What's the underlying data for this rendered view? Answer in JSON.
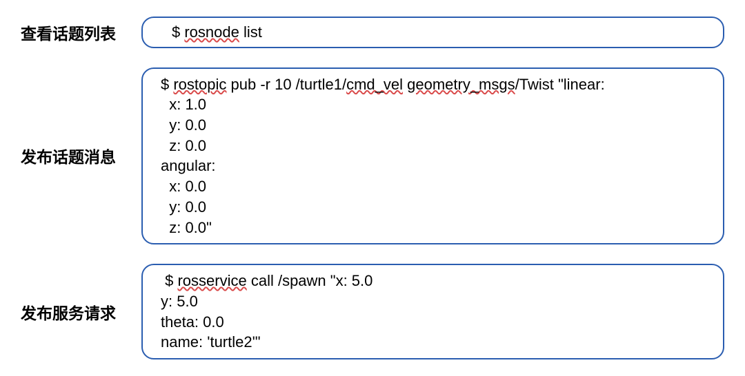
{
  "rows": [
    {
      "label": "查看话题列表",
      "parts": [
        {
          "text": "$ ",
          "u": false
        },
        {
          "text": "rosnode",
          "u": true
        },
        {
          "text": " list",
          "u": false
        }
      ],
      "single": true
    },
    {
      "label": "发布话题消息",
      "parts": [
        {
          "text": "$ ",
          "u": false
        },
        {
          "text": "rostopic",
          "u": true
        },
        {
          "text": " pub -r 10 /turtle1/",
          "u": false
        },
        {
          "text": "cmd_vel",
          "u": true
        },
        {
          "text": " ",
          "u": false
        },
        {
          "text": "geometry_msgs",
          "u": true
        },
        {
          "text": "/Twist \"linear:\n  x: 1.0\n  y: 0.0\n  z: 0.0\nangular:\n  x: 0.0\n  y: 0.0\n  z: 0.0\"",
          "u": false
        }
      ],
      "single": false
    },
    {
      "label": "发布服务请求",
      "parts": [
        {
          "text": " $ ",
          "u": false
        },
        {
          "text": "rosservice",
          "u": true
        },
        {
          "text": " call /spawn \"x: 5.0\ny: 5.0\ntheta: 0.0\nname: 'turtle2'\"",
          "u": false
        }
      ],
      "single": false
    }
  ]
}
